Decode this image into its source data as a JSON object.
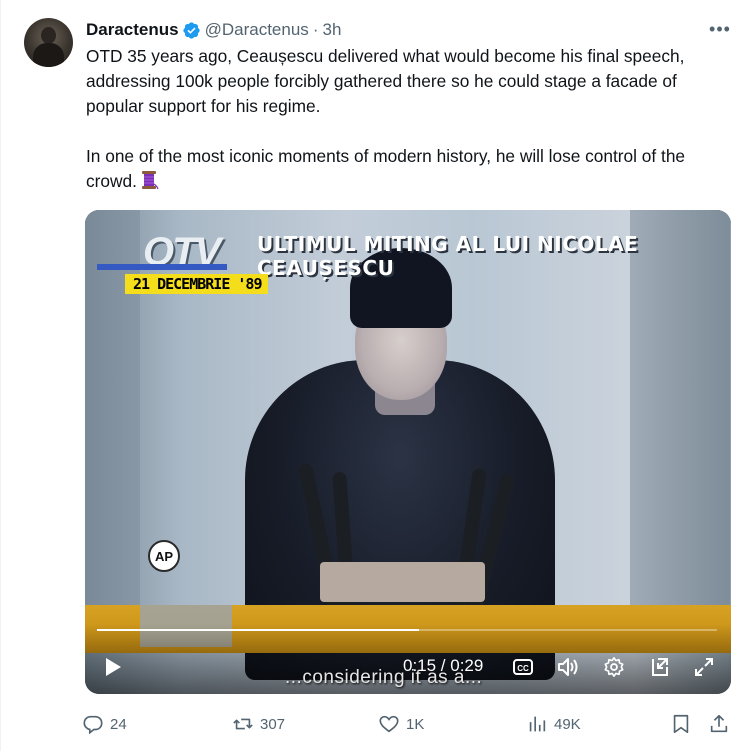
{
  "author": {
    "display_name": "Daractenus",
    "handle": "@Daractenus",
    "separator": "·",
    "time": "3h",
    "verified_icon": "verified-badge-icon"
  },
  "more_label": "•••",
  "tweet": {
    "paragraph1": "OTD 35 years ago, Ceaușescu delivered what would become his final speech, addressing 100k people forcibly gathered there so he could stage a facade of popular support for his regime.",
    "paragraph2": "In one of the most iconic moments of modern history, he will lose control of the crowd.",
    "emoji_icon": "thread-spool-icon"
  },
  "video": {
    "logo": "OTV",
    "top_caption": "ULTIMUL MITING AL LUI NICOLAE CEAUȘESCU",
    "date": "21 DECEMBRIE '89",
    "watermark": "AP",
    "subtitle": "...considering it as a...",
    "current_time": "0:15",
    "duration": "0:29",
    "time_display": "0:15 / 0:29",
    "progress": 0.52,
    "controls": [
      "play-icon",
      "captions-icon",
      "volume-icon",
      "settings-icon",
      "pip-icon",
      "fullscreen-icon"
    ]
  },
  "actions": {
    "replies": "24",
    "reposts": "307",
    "likes": "1K",
    "views": "49K"
  },
  "colors": {
    "accent": "#1d9bf0",
    "text_primary": "#0f1419",
    "text_secondary": "#536471"
  }
}
